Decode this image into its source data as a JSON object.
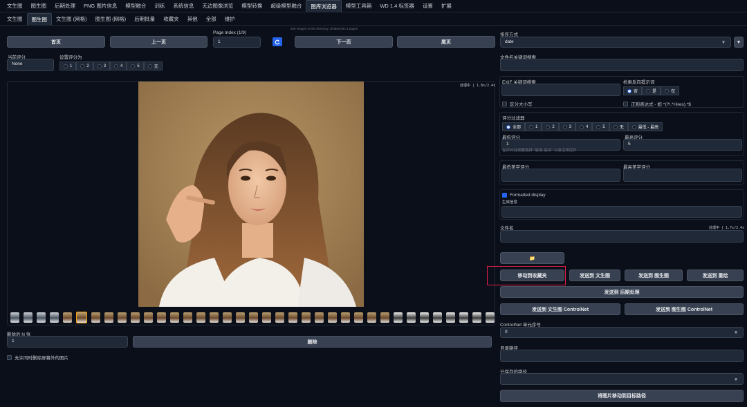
{
  "top_tabs": [
    "文生图",
    "图生图",
    "后期处理",
    "PNG 图片信息",
    "模型融合",
    "训练",
    "系统信息",
    "无边图像浏览",
    "模型转换",
    "超级模型融合",
    "图库浏览器",
    "模型工具箱",
    "WD 1.4 标签器",
    "设置",
    "扩展"
  ],
  "sub_tabs": [
    "文生图",
    "图生图",
    "文生图 (网格)",
    "图生图 (网格)",
    "后期批量",
    "收藏夹",
    "其他",
    "全部",
    "维护"
  ],
  "info_line": "306 images in this directory, divided into 4 pages",
  "nav": {
    "first": "首页",
    "prev": "上一页",
    "next": "下一页",
    "last": "尾页",
    "page_index_label": "Page Index (1/9)",
    "page_index_value": "1"
  },
  "rating": {
    "current_label": "当前评分",
    "current_value": "None",
    "set_label": "设置评分为",
    "options": [
      "1",
      "2",
      "3",
      "4",
      "5",
      "无"
    ]
  },
  "preview_status": "处理中 | 1.8s/2.4s",
  "delete": {
    "label": "删除后 N 张",
    "value": "1",
    "button": "删除",
    "allow_label": "允许同时删除屏幕外的图片"
  },
  "sort": {
    "label": "排序方式",
    "value": "date",
    "order_icon": "▼"
  },
  "filename_search_label": "文件名关键词搜索",
  "exif": {
    "label": "EXIF 关键词搜索",
    "neg_label": "检索反向提示词",
    "neg_options": [
      "否",
      "是",
      "仅"
    ],
    "case_label": "区分大小写",
    "regex_label": "正则表达式 - 如 ^(?!.*Hires).*$"
  },
  "rating_filter": {
    "label": "评分过滤器",
    "options": [
      "全部",
      "1",
      "2",
      "3",
      "4",
      "5",
      "无",
      "最低 - 最高"
    ],
    "min_label": "最低评分",
    "min_value": "1",
    "max_label": "最高评分",
    "max_value": "5",
    "hint": "在评分过滤器选择 \"最低-最高\" 以激活该控件"
  },
  "aesthetic": {
    "min_label": "最低美学评分",
    "max_label": "最高美学评分"
  },
  "formatted": {
    "label": "Formatted display",
    "sub_label": "生成信息"
  },
  "filename": {
    "label": "文件名",
    "status": "处理中 | 1.7s/2.4s"
  },
  "actions": {
    "folder_icon": "📁",
    "move_fav": "移动到收藏夹",
    "send_txt2img": "发送到 文生图",
    "send_img2img": "发送到 图生图",
    "send_inpaint": "发送到 重绘",
    "send_extras": "发送到 后期处理",
    "send_txt2img_cn": "发送到 文生图 ControlNet",
    "send_img2img_cn": "发送到 图生图 ControlNet"
  },
  "controlnet": {
    "label": "ControlNet 单元序号",
    "value": "0"
  },
  "dir_path_label": "目录路径",
  "saved_paths_label": "已保存的路径",
  "move_target_button": "将图片移动到目标路径",
  "colors": {
    "accent": "#2563eb",
    "highlight": "#e11d48",
    "bg": "#0b0f19"
  }
}
